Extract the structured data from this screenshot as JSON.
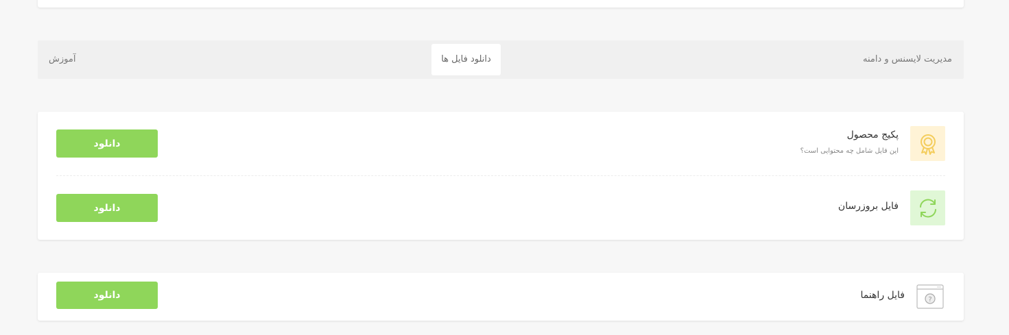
{
  "tabs": {
    "license": "مدیریت لایسنس و دامنه",
    "downloads": "دانلود فایل ها",
    "tutorial": "آموزش"
  },
  "files": [
    {
      "title": "پکیج محصول",
      "subtitle": "این فایل شامل چه محتوایی است؟",
      "button": "دانلود",
      "icon": "award-badge-icon"
    },
    {
      "title": "فایل بروزرسان",
      "button": "دانلود",
      "icon": "sync-icon"
    },
    {
      "title": "فایل راهنما",
      "button": "دانلود",
      "icon": "help-window-icon"
    }
  ],
  "colors": {
    "accent": "#8fd65a",
    "badge_bg": "#fff3d6",
    "badge_icon": "#f4cd5c",
    "sync_bg": "#e0f7d6",
    "sync_icon": "#8fd65a"
  }
}
